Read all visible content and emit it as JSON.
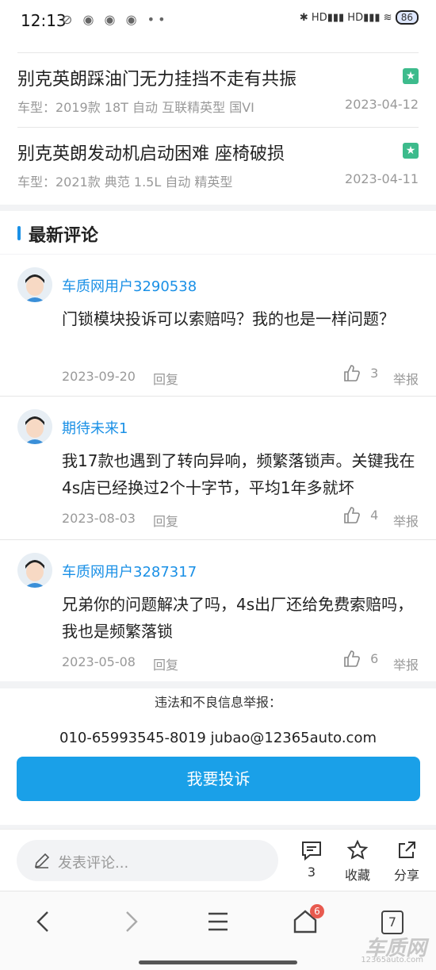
{
  "status_bar": {
    "time": "12:13",
    "battery": "86",
    "icons": "⊘ ◉ ◉ ◉ ••",
    "right_icons": "✱ HD▮▮▮ HD▮▮▮ ≋"
  },
  "complaints": [
    {
      "title": "别克英朗踩油门无力挂挡不走有共振",
      "meta": "车型：2019款 18T 自动 互联精英型 国VI",
      "date": "2023-04-12"
    },
    {
      "title": "别克英朗发动机启动困难 座椅破损",
      "meta": "车型：2021款 典范 1.5L 自动 精英型",
      "date": "2023-04-11"
    }
  ],
  "section_title": "最新评论",
  "comments": [
    {
      "user": "车质网用户3290538",
      "text": "门锁模块投诉可以索赔吗？我的也是一样问题？",
      "date": "2023-09-20",
      "reply": "回复",
      "likes": "3",
      "report": "举报"
    },
    {
      "user": "期待未来1",
      "text": "我17款也遇到了转向异响，频繁落锁声。关键我在4s店已经换过2个十字节，平均1年多就坏",
      "date": "2023-08-03",
      "reply": "回复",
      "likes": "4",
      "report": "举报"
    },
    {
      "user": "车质网用户3287317",
      "text": "兄弟你的问题解决了吗，4s出厂还给免费索赔吗，我也是频繁落锁",
      "date": "2023-05-08",
      "reply": "回复",
      "likes": "6",
      "report": "举报"
    }
  ],
  "footer": {
    "report_label": "违法和不良信息举报：",
    "contact": "010-65993545-8019  jubao@12365auto.com",
    "complain_button": "我要投诉"
  },
  "bottom_bar": {
    "comment_placeholder": "发表评论...",
    "comment_count": "3",
    "favorite_label": "收藏",
    "share_label": "分享"
  },
  "nav": {
    "tab_count": "7",
    "home_badge": "6"
  },
  "watermark": {
    "main": "车质网",
    "sub": "12365auto.com"
  },
  "colors": {
    "accent": "#1a90e6",
    "button": "#1aa0e8",
    "badge": "#3dbb8c"
  }
}
